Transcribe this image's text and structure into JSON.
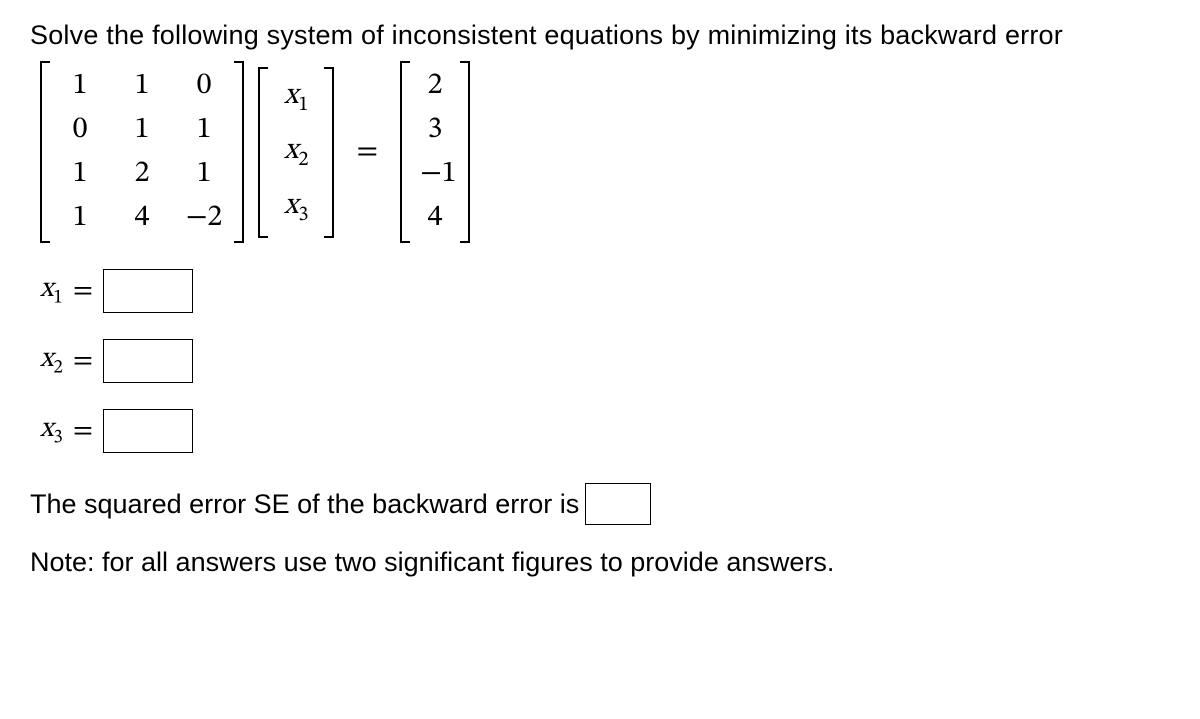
{
  "prompt": "Solve the following system of inconsistent equations by minimizing its backward error",
  "matrixA": {
    "r0c0": "1",
    "r0c1": "1",
    "r0c2": "0",
    "r1c0": "0",
    "r1c1": "1",
    "r1c2": "1",
    "r2c0": "1",
    "r2c1": "2",
    "r2c2": "1",
    "r3c0": "1",
    "r3c1": "4",
    "r3c2": "−2"
  },
  "vectorX": {
    "x1": "x",
    "s1": "1",
    "x2": "x",
    "s2": "2",
    "x3": "x",
    "s3": "3"
  },
  "eq_sign": "=",
  "vectorB": {
    "b0": "2",
    "b1": "3",
    "b2": "−1",
    "b3": "4"
  },
  "answers": {
    "x1_label_var": "x",
    "x1_label_sub": "1",
    "x1_eq": "=",
    "x2_label_var": "x",
    "x2_label_sub": "2",
    "x2_eq": "=",
    "x3_label_var": "x",
    "x3_label_sub": "3",
    "x3_eq": "="
  },
  "se_text": "The squared error SE of the backward error is",
  "note": "Note: for all answers use two significant figures to provide answers."
}
